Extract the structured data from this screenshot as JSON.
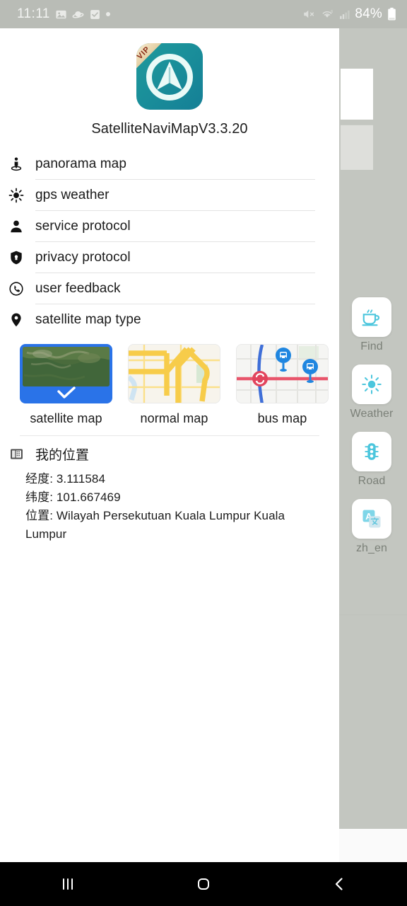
{
  "statusbar": {
    "time": "11:11",
    "battery_text": "84%",
    "left_icons": [
      "image-icon",
      "saturn-icon",
      "checkbox-icon",
      "dot-icon"
    ],
    "right_icons": [
      "mute-icon",
      "wifi-icon",
      "signal-icon",
      "battery-icon"
    ],
    "background_color": "#b9bcb6"
  },
  "app": {
    "title": "SatelliteNaviMapV3.3.20",
    "vip_badge": "VIP",
    "icon_name": "satellite-navi-map-app-icon",
    "icon_color": "#1a8f9a"
  },
  "menu": {
    "items": [
      {
        "label": "panorama map",
        "icon": "street-view-icon"
      },
      {
        "label": "gps weather",
        "icon": "sun-icon"
      },
      {
        "label": "service protocol",
        "icon": "user-icon"
      },
      {
        "label": "privacy protocol",
        "icon": "shield-lock-icon"
      },
      {
        "label": "user feedback",
        "icon": "phone-circle-icon"
      },
      {
        "label": "satellite map type",
        "icon": "location-pin-icon"
      }
    ]
  },
  "map_types": {
    "selected": "satellite map",
    "selected_color": "#2a73e8",
    "options": [
      {
        "label": "satellite map",
        "thumb": "satellite-thumbnail",
        "selected": true
      },
      {
        "label": "normal map",
        "thumb": "normal-map-thumbnail",
        "selected": false
      },
      {
        "label": "bus map",
        "thumb": "bus-map-thumbnail",
        "selected": false
      }
    ]
  },
  "location": {
    "icon": "building-icon",
    "title": "我的位置",
    "longitude_line": "经度: 3.111584",
    "latitude_line": "纬度: 101.667469",
    "address_line": "位置: Wilayah Persekutuan Kuala Lumpur Kuala Lumpur"
  },
  "tool_rail": {
    "items": [
      {
        "label": "Find",
        "icon": "coffee-cup-icon"
      },
      {
        "label": "Weather",
        "icon": "sun-icon"
      },
      {
        "label": "Road",
        "icon": "traffic-light-icon"
      },
      {
        "label": "zh_en",
        "icon": "translate-icon"
      }
    ]
  },
  "navbar": {
    "recents_label": "recent-apps",
    "home_label": "home",
    "back_label": "back"
  }
}
